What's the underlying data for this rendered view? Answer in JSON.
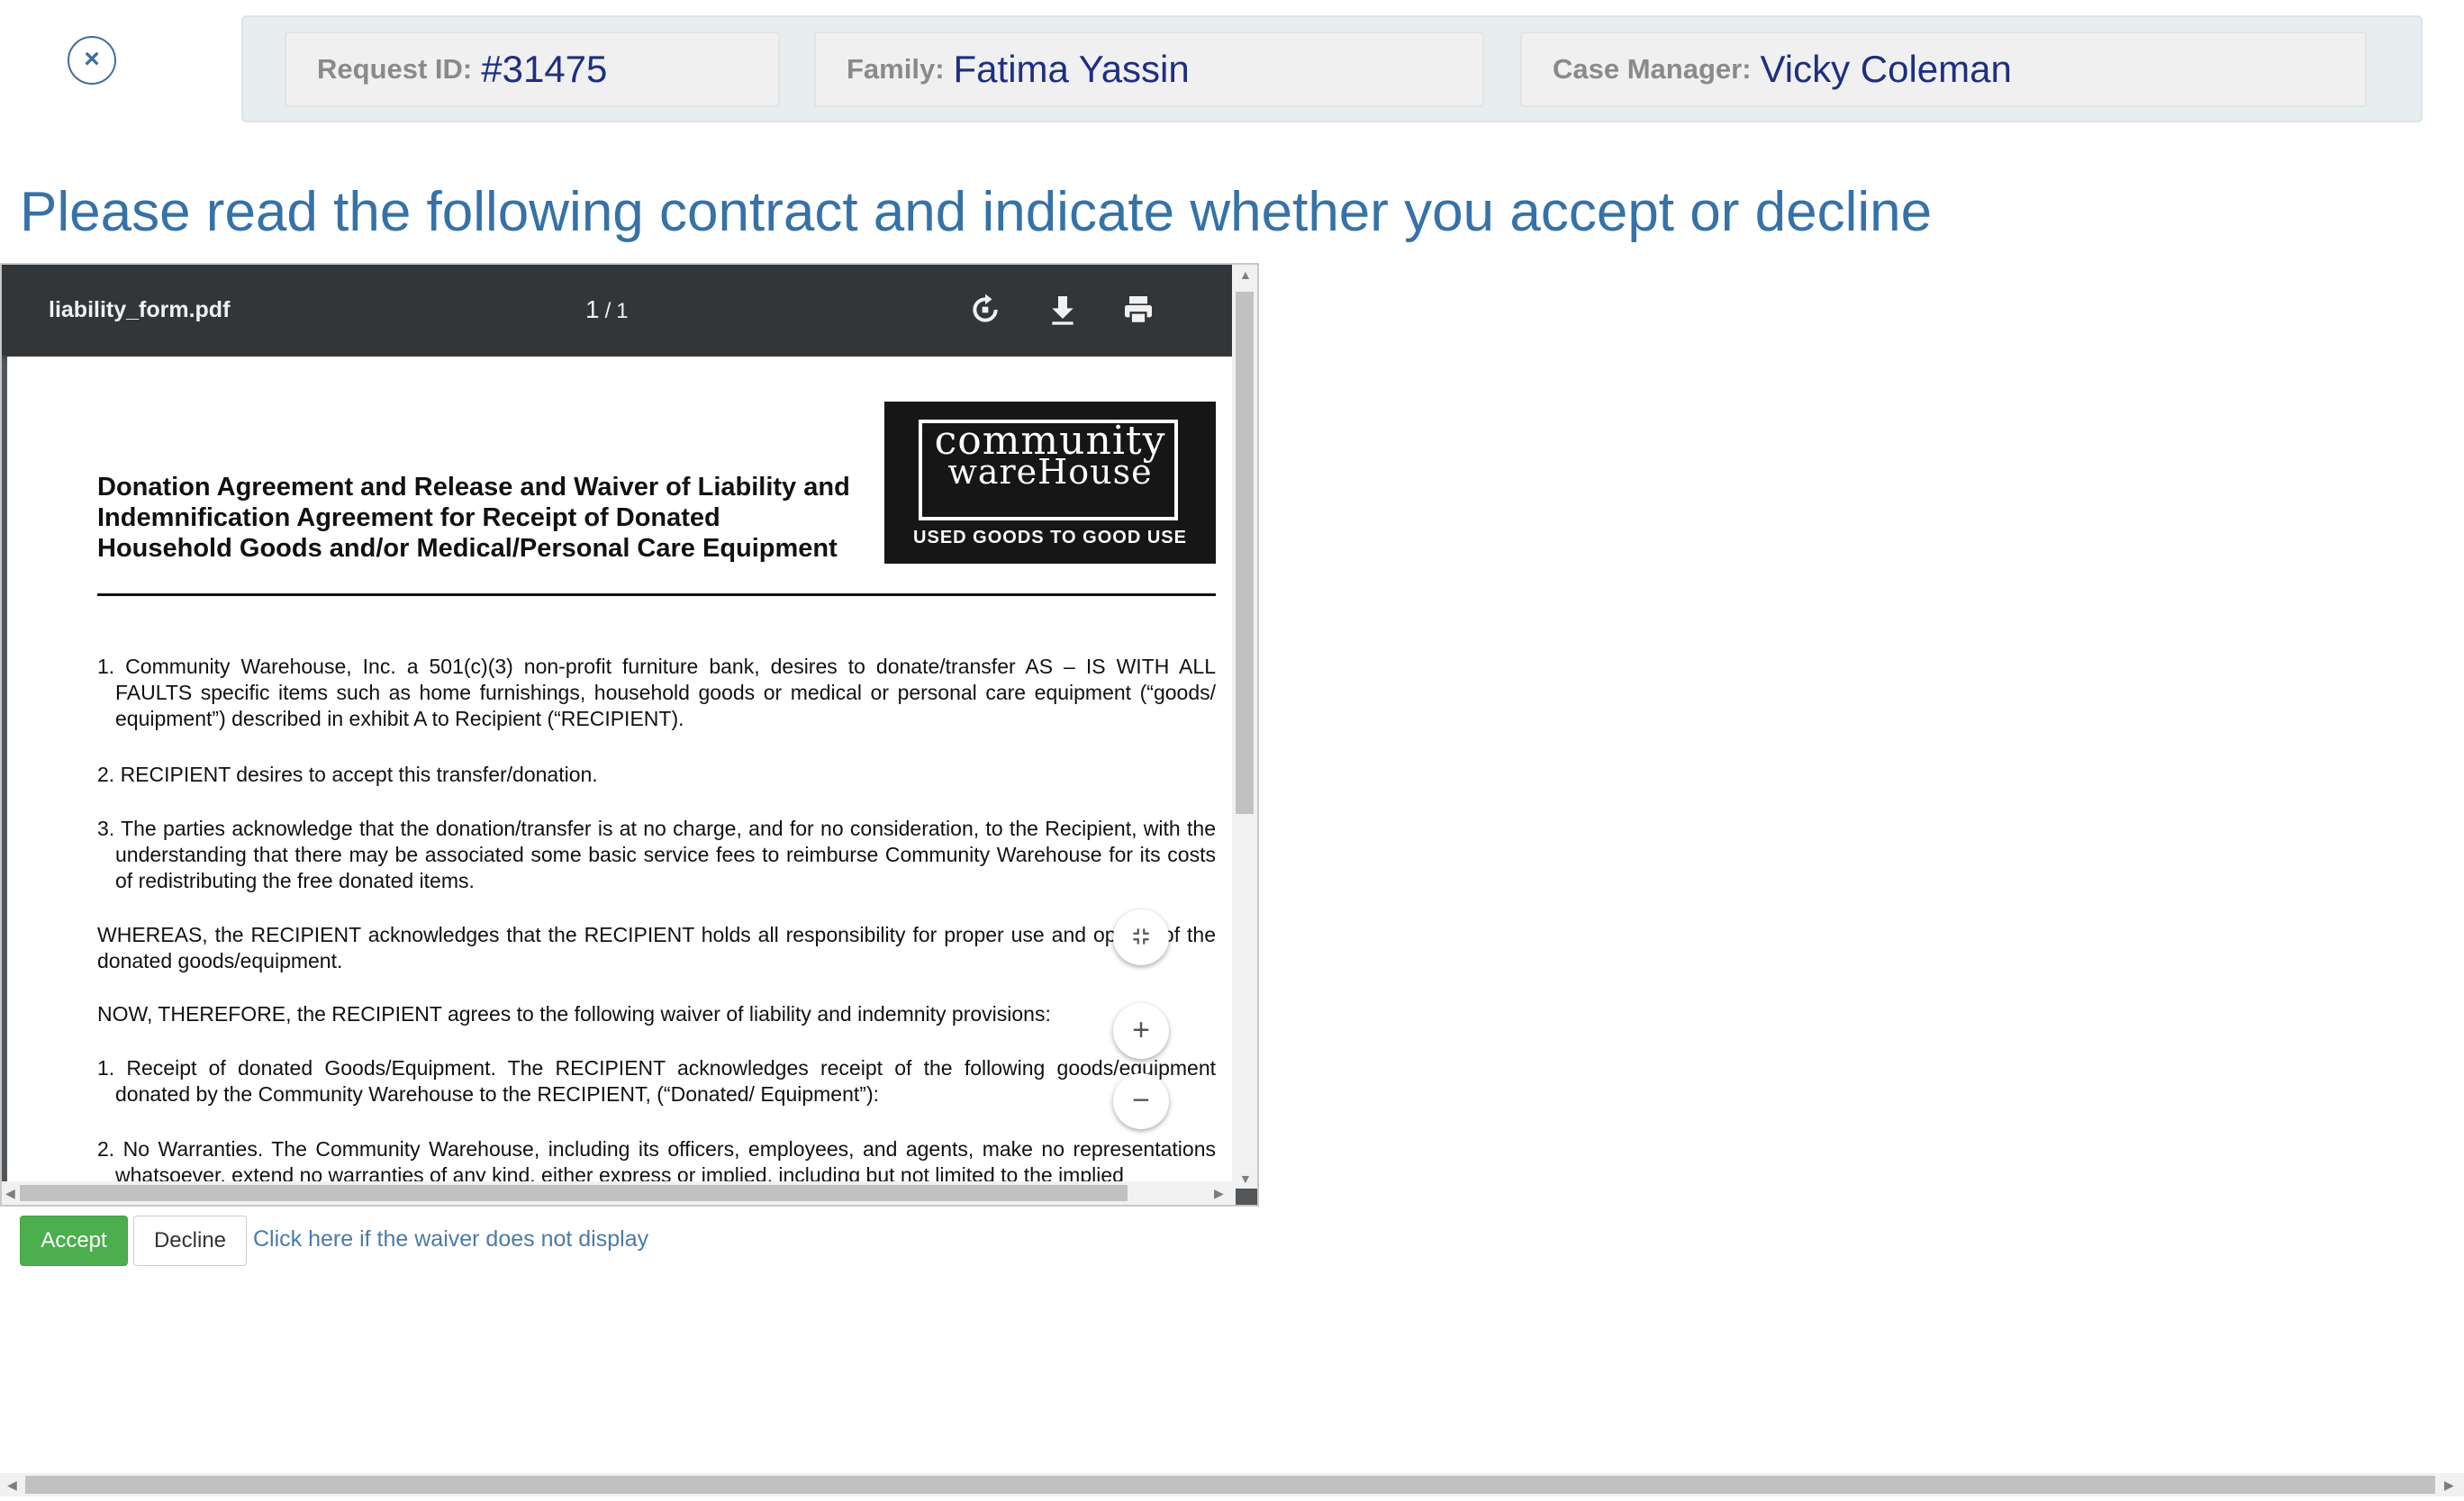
{
  "close_button": {
    "symbol": "×"
  },
  "info": {
    "request_label": "Request ID:",
    "request_value": "#31475",
    "family_label": "Family:",
    "family_value": "Fatima Yassin",
    "manager_label": "Case Manager:",
    "manager_value": "Vicky Coleman"
  },
  "heading": "Please read the following contract and indicate whether you accept or decline",
  "pdf": {
    "filename": "liability_form.pdf",
    "current_page": "1",
    "page_separator": "/",
    "total_pages": "1",
    "toolbar_icons": [
      "rotate-icon",
      "download-icon",
      "print-icon"
    ],
    "zoom_icons": [
      "fit-page-icon",
      "zoom-in-icon",
      "zoom-out-icon"
    ],
    "zoom_in_symbol": "+",
    "zoom_out_symbol": "−",
    "document": {
      "title": "Donation Agreement and Release and Waiver of Liability and Indemnification Agreement for Receipt of Donated Household Goods and/or Medical/Personal Care Equipment",
      "logo_line1": "community",
      "logo_line2": "wareHouse",
      "logo_tagline": "USED GOODS TO GOOD USE",
      "paragraphs": [
        "1. Community Warehouse, Inc. a 501(c)(3) non-profit furniture bank, desires to donate/transfer AS – IS WITH ALL FAULTS specific items such as home furnishings, household goods or medical or personal care equipment (“goods/ equipment”) described in exhibit A to Recipient (“RECIPIENT).",
        "2. RECIPIENT desires to accept this transfer/donation.",
        "3. The parties acknowledge that the donation/transfer is at no charge, and for no consideration, to the Recipient, with the understanding that there may be associated some basic service fees to reimburse Community Warehouse for its costs of redistributing the free donated items.",
        "WHEREAS, the RECIPIENT acknowledges that the RECIPIENT holds all responsibility for proper use and oper… of the donated goods/equipment.",
        "NOW, THEREFORE, the RECIPIENT agrees to the following waiver of liability and indemnity provisions:",
        "1. Receipt of donated Goods/Equipment. The RECIPIENT acknowledges receipt of the following goods/equipment donated by the Community Warehouse to the RECIPIENT, (“Donated/ Equipment”):",
        "2. No Warranties. The Community Warehouse, including its officers, employees, and agents, make no representations whatsoever, extend no warranties of any kind, either express or implied, including but not limited to the implied"
      ]
    }
  },
  "actions": {
    "accept": "Accept",
    "decline": "Decline",
    "help_link": "Click here if the waiver does not display"
  },
  "colors": {
    "heading": "#3572a8",
    "info_value": "#1d2f80",
    "accept_bg": "#4cae4c",
    "pdf_toolbar": "#323639"
  }
}
